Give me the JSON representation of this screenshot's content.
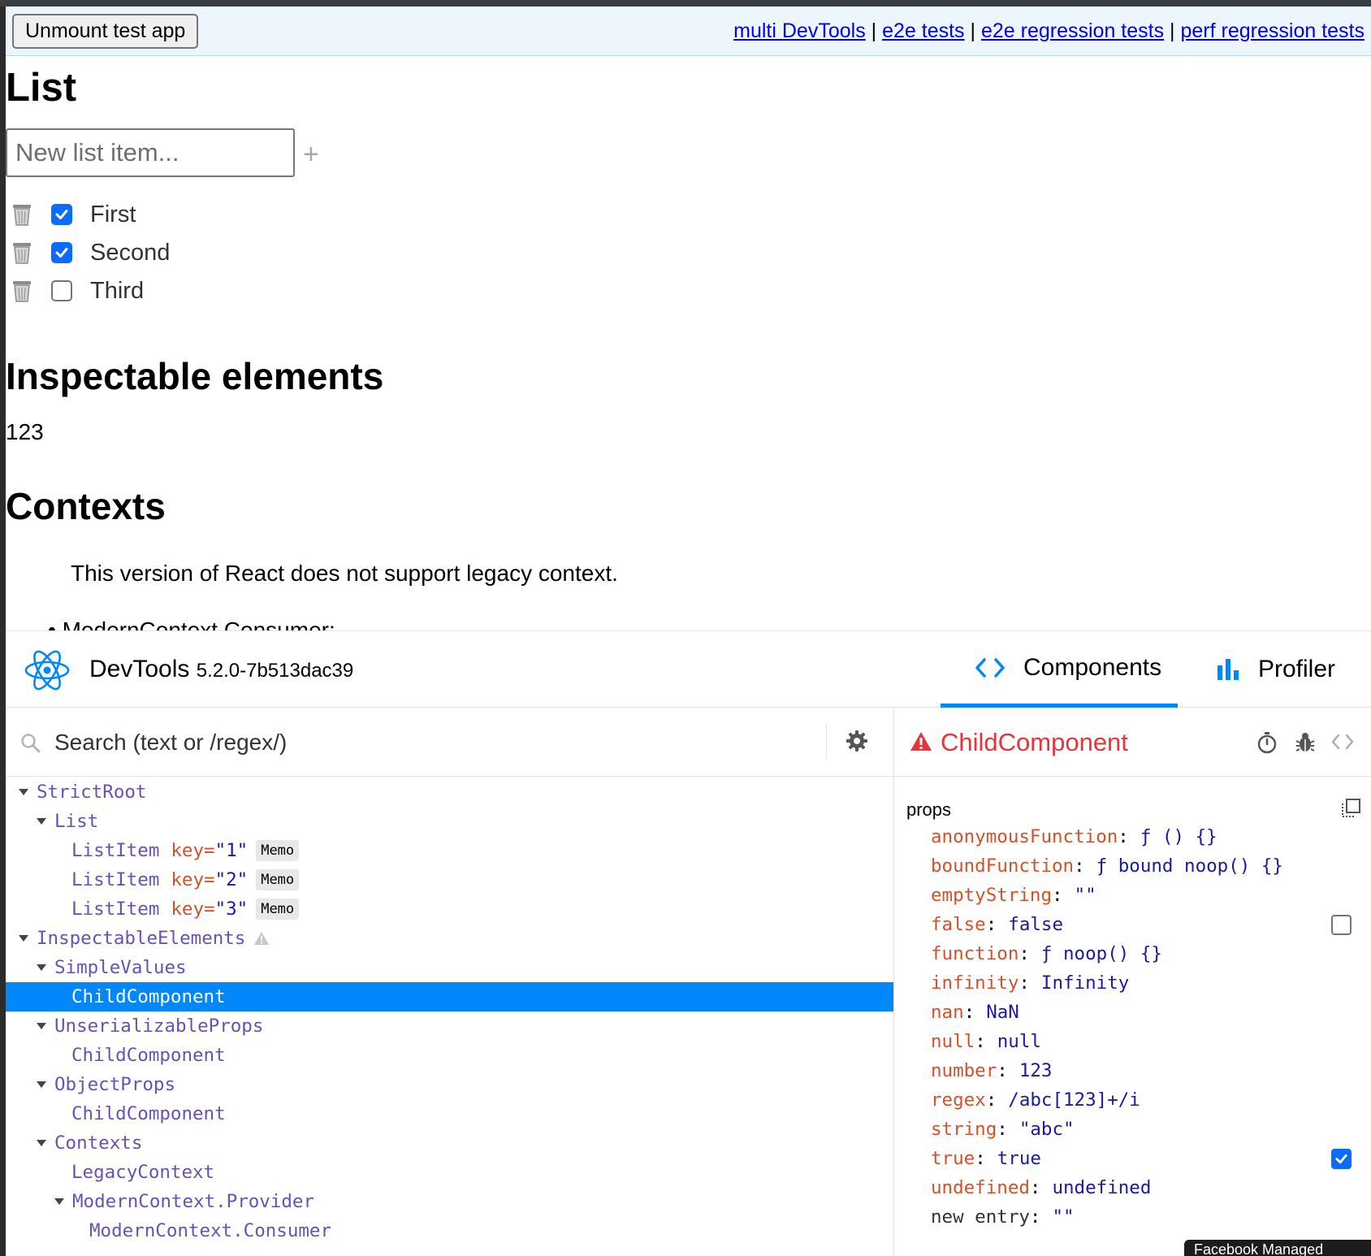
{
  "test_app": {
    "unmount_label": "Unmount test app",
    "links": [
      "multi DevTools",
      "e2e tests",
      "e2e regression tests",
      "perf regression tests"
    ],
    "link_separator": "|",
    "list_heading": "List",
    "new_item_placeholder": "New list item...",
    "add_symbol": "+",
    "items": [
      {
        "label": "First",
        "checked": true
      },
      {
        "label": "Second",
        "checked": true
      },
      {
        "label": "Third",
        "checked": false
      }
    ],
    "inspectable_heading": "Inspectable elements",
    "inspectable_value": "123",
    "contexts_heading": "Contexts",
    "legacy_message": "This version of React does not support legacy context.",
    "bullet_text": "ModernContext.Consumer:"
  },
  "devtools": {
    "title": "DevTools",
    "version": "5.2.0-7b513dac39",
    "tabs": [
      {
        "label": "Components",
        "icon": "code-brackets-icon",
        "active": true
      },
      {
        "label": "Profiler",
        "icon": "bar-chart-icon",
        "active": false
      }
    ],
    "accent_color": "#0088fa",
    "search_placeholder": "Search (text or /regex/)",
    "tree": [
      {
        "name": "StrictRoot",
        "depth": 0,
        "expanded": true
      },
      {
        "name": "List",
        "depth": 1,
        "expanded": true
      },
      {
        "name": "ListItem",
        "depth": 2,
        "key_label": "key=",
        "key": "\"1\"",
        "badge": "Memo"
      },
      {
        "name": "ListItem",
        "depth": 2,
        "key_label": "key=",
        "key": "\"2\"",
        "badge": "Memo"
      },
      {
        "name": "ListItem",
        "depth": 2,
        "key_label": "key=",
        "key": "\"3\"",
        "badge": "Memo"
      },
      {
        "name": "InspectableElements",
        "depth": 0,
        "expanded": true,
        "warning": true
      },
      {
        "name": "SimpleValues",
        "depth": 1,
        "expanded": true
      },
      {
        "name": "ChildComponent",
        "depth": 2,
        "selected": true
      },
      {
        "name": "UnserializableProps",
        "depth": 1,
        "expanded": true
      },
      {
        "name": "ChildComponent",
        "depth": 2
      },
      {
        "name": "ObjectProps",
        "depth": 1,
        "expanded": true
      },
      {
        "name": "ChildComponent",
        "depth": 2
      },
      {
        "name": "Contexts",
        "depth": 1,
        "expanded": true
      },
      {
        "name": "LegacyContext",
        "depth": 2
      },
      {
        "name": "ModernContext.Provider",
        "depth": 2,
        "expanded": true
      },
      {
        "name": "ModernContext.Consumer",
        "depth": 3
      }
    ],
    "selected_component": "ChildComponent",
    "props_label": "props",
    "props": [
      {
        "key": "anonymousFunction",
        "value": "ƒ () {}"
      },
      {
        "key": "boundFunction",
        "value": "ƒ bound noop() {}"
      },
      {
        "key": "emptyString",
        "value": "\"\""
      },
      {
        "key": "false",
        "value": "false",
        "checkbox": "off"
      },
      {
        "key": "function",
        "value": "ƒ noop() {}"
      },
      {
        "key": "infinity",
        "value": "Infinity"
      },
      {
        "key": "nan",
        "value": "NaN"
      },
      {
        "key": "null",
        "value": "null"
      },
      {
        "key": "number",
        "value": "123"
      },
      {
        "key": "regex",
        "value": "/abc[123]+/i"
      },
      {
        "key": "string",
        "value": "\"abc\""
      },
      {
        "key": "true",
        "value": "true",
        "checkbox": "on"
      },
      {
        "key": "undefined",
        "value": "undefined"
      },
      {
        "key": "new entry",
        "value": "\"\"",
        "new_entry": true
      }
    ],
    "overlay_text": "Facebook Managed"
  }
}
